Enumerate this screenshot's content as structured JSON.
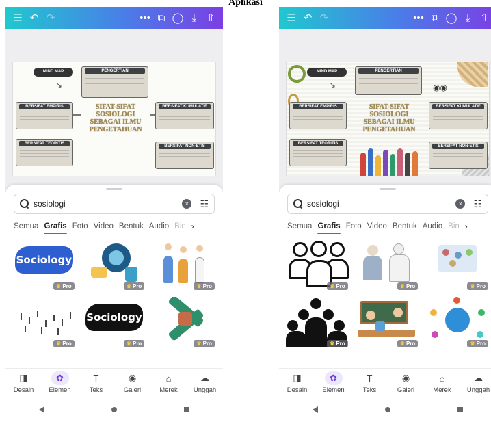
{
  "caption": "Aplikasi",
  "toolbar": {
    "menu_icon": "☰",
    "undo_icon": "↶",
    "redo_icon": "↷",
    "more_icon": "•••",
    "layers_icon": "⧉",
    "comment_icon": "◯",
    "download_icon": "⤓",
    "share_icon": "⇧"
  },
  "design": {
    "mind_map_label": "MIND MAP",
    "title": "SIFAT-SIFAT SOSIOLOGI SEBAGAI ILMU PENGETAHUAN",
    "boxes": {
      "pengertian": "PENGERTIAN",
      "empiris": "BERSIFAT EMPIRIS",
      "kumulatif": "BERSIFAT KUMULATIF",
      "teoritis": "BERSIFAT TEORITIS",
      "non_etis": "BERSIFAT NON-ETIS"
    }
  },
  "search": {
    "value": "sosiologi"
  },
  "tabs": [
    "Semua",
    "Grafis",
    "Foto",
    "Video",
    "Bentuk",
    "Audio",
    "Bin"
  ],
  "tab_chevron": "›",
  "pro_label": "Pro",
  "crown_icon": "♛",
  "art_text": {
    "sociology_blue": "Sociology",
    "sociology_dark": "Sociology"
  },
  "bottom_nav": [
    {
      "label": "Desain",
      "icon": "◨"
    },
    {
      "label": "Elemen",
      "icon": "✿"
    },
    {
      "label": "Teks",
      "icon": "T"
    },
    {
      "label": "Galeri",
      "icon": "◉"
    },
    {
      "label": "Merek",
      "icon": "⌂"
    },
    {
      "label": "Unggah",
      "icon": "☁"
    }
  ],
  "colors": {
    "gradient_start": "#1fc8cf",
    "gradient_end": "#7b3fe4",
    "accent": "#7d4ae6"
  }
}
